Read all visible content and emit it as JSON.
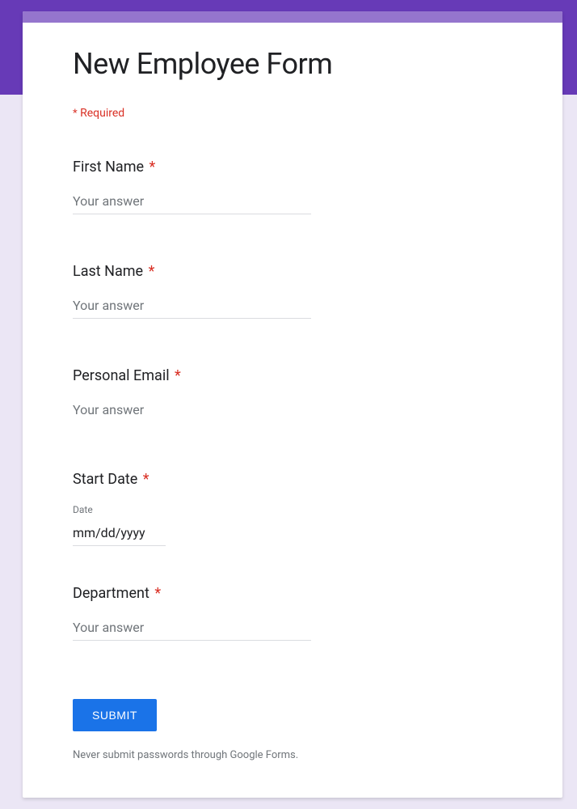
{
  "form": {
    "title": "New Employee Form",
    "required_note": "Required",
    "fields": {
      "first_name": {
        "label": "First Name",
        "placeholder": "Your answer"
      },
      "last_name": {
        "label": "Last Name",
        "placeholder": "Your answer"
      },
      "personal_email": {
        "label": "Personal Email",
        "placeholder": "Your answer"
      },
      "start_date": {
        "label": "Start Date",
        "sublabel": "Date",
        "value": "mm/dd/yyyy"
      },
      "department": {
        "label": "Department",
        "placeholder": "Your answer"
      }
    },
    "submit_label": "SUBMIT",
    "footer_note": "Never submit passwords through Google Forms."
  }
}
